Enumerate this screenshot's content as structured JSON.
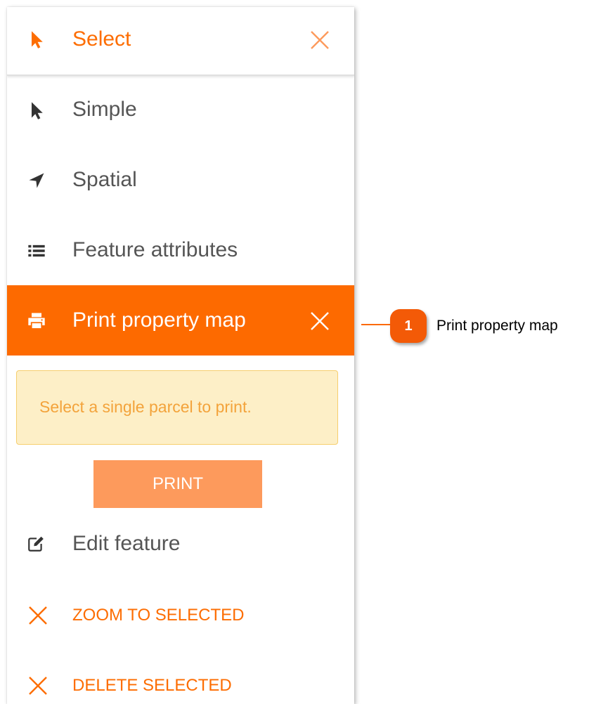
{
  "colors": {
    "accent": "#fd6d02",
    "active_row_bg": "#fd6a00",
    "text_dark": "#333333",
    "text_muted": "#555555",
    "alert_bg": "#fdefc7",
    "alert_border": "#f6ce6e",
    "alert_text": "#f3a33b",
    "print_button_bg": "#fd9a5c",
    "badge_bg": "#f35a07"
  },
  "panel": {
    "header": {
      "title": "Select",
      "icon": "cursor-arrow-icon",
      "close_icon": "close-icon"
    },
    "items": [
      {
        "label": "Simple",
        "icon": "cursor-arrow-icon"
      },
      {
        "label": "Spatial",
        "icon": "location-arrow-icon"
      },
      {
        "label": "Feature attributes",
        "icon": "list-icon"
      }
    ],
    "active_item": {
      "label": "Print property map",
      "icon": "printer-icon",
      "close_icon": "close-icon"
    },
    "alert": {
      "text": "Select a single parcel to print."
    },
    "print_button": {
      "label": "PRINT"
    },
    "edit_item": {
      "label": "Edit feature",
      "icon": "edit-icon"
    },
    "actions": [
      {
        "label": "ZOOM TO SELECTED",
        "icon": "close-icon"
      },
      {
        "label": "DELETE SELECTED",
        "icon": "close-icon"
      }
    ]
  },
  "callout": {
    "number": "1",
    "text": "Print property map"
  }
}
